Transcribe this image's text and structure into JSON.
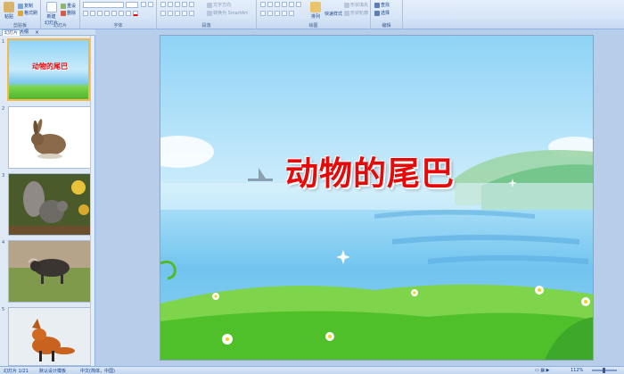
{
  "ribbon": {
    "clipboard": {
      "paste": "粘贴",
      "copy": "复制",
      "format_painter": "格式刷",
      "label": "剪贴板"
    },
    "slides": {
      "new_slide": "新建\n幻灯片",
      "reset": "重设",
      "delete": "删除",
      "label": "幻灯片"
    },
    "font": {
      "label": "字体"
    },
    "paragraph": {
      "text_direction": "文字方向",
      "smartart": "转换为 SmartArt",
      "label": "段落"
    },
    "drawing": {
      "arrange": "排列",
      "quick_styles": "快速样式",
      "shape_fill": "形状填充",
      "shape_outline": "形状轮廓",
      "label": "绘图"
    },
    "editing": {
      "find": "查找",
      "select": "选择",
      "label": "编辑"
    }
  },
  "panel": {
    "tabs": [
      "幻灯片",
      "大纲"
    ],
    "thumbs": [
      {
        "num": "1",
        "title": "动物的尾巴"
      },
      {
        "num": "2"
      },
      {
        "num": "3"
      },
      {
        "num": "4"
      },
      {
        "num": "5"
      }
    ]
  },
  "slide": {
    "title": "动物的尾巴"
  },
  "status": {
    "slide_info": "幻灯片 1/21",
    "theme": "默认设计模板",
    "language": "中文(简体，中国)",
    "zoom": "112%"
  },
  "colors": {
    "title_red": "#e50a0a",
    "ribbon_bg": "#d7e5f7",
    "selection": "#f5b74a"
  }
}
